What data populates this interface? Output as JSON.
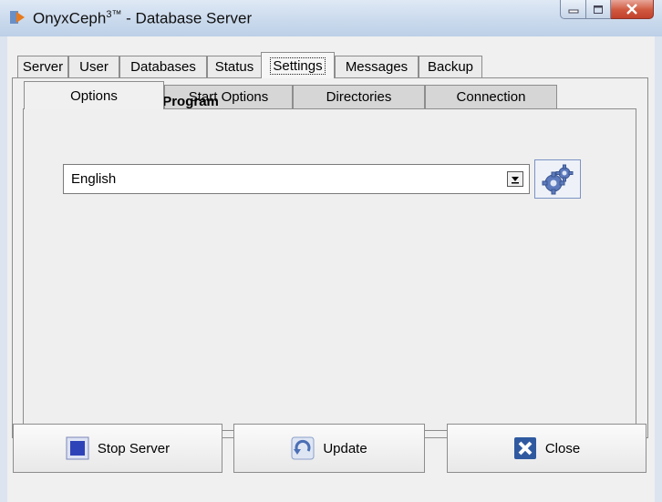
{
  "window": {
    "title_prefix": "OnyxCeph",
    "title_sup": "3™",
    "title_suffix": " - Database Server"
  },
  "main_tabs": [
    {
      "label": "Server"
    },
    {
      "label": "User"
    },
    {
      "label": "Databases"
    },
    {
      "label": "Status"
    },
    {
      "label": "Settings",
      "active": true
    },
    {
      "label": "Messages"
    },
    {
      "label": "Backup"
    }
  ],
  "sub_tabs": [
    {
      "label": "Options",
      "active": true
    },
    {
      "label": "Start Options"
    },
    {
      "label": "Directories"
    },
    {
      "label": "Connection"
    }
  ],
  "options": {
    "section_label": "Language of Server Program",
    "language_value": "English"
  },
  "buttons": {
    "stop": "Stop Server",
    "update": "Update",
    "close": "Close"
  },
  "colors": {
    "stop_icon": "#2f43b8",
    "update_icon": "#4a6fb5",
    "close_icon": "#2f5aa0"
  },
  "icons": [
    "app-icon",
    "minimize-icon",
    "maximize-icon",
    "close-window-icon",
    "dropdown-arrow-icon",
    "gears-icon",
    "stop-icon",
    "update-icon",
    "close-icon"
  ]
}
